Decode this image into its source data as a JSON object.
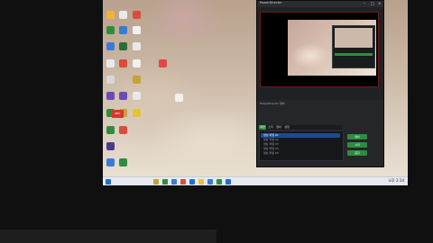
{
  "app": {
    "title": "PowerDirector",
    "controls_label": "PowerDirector 캡처",
    "record_label": "REC",
    "tabs": [
      "화면",
      "소리",
      "캡처",
      "설정"
    ],
    "list_rows": [
      "영상 파일 01",
      "영상 파일 02",
      "영상 파일 03",
      "영상 파일 04",
      "영상 파일 05"
    ],
    "side_buttons": [
      "캡처",
      "시작",
      "중지"
    ]
  },
  "taskbar": {
    "clock": "오후 2:14"
  },
  "colors": {
    "accent_green": "#2f8c3f",
    "record_red": "#d33a2c",
    "selection_blue": "#1d4a8f"
  }
}
